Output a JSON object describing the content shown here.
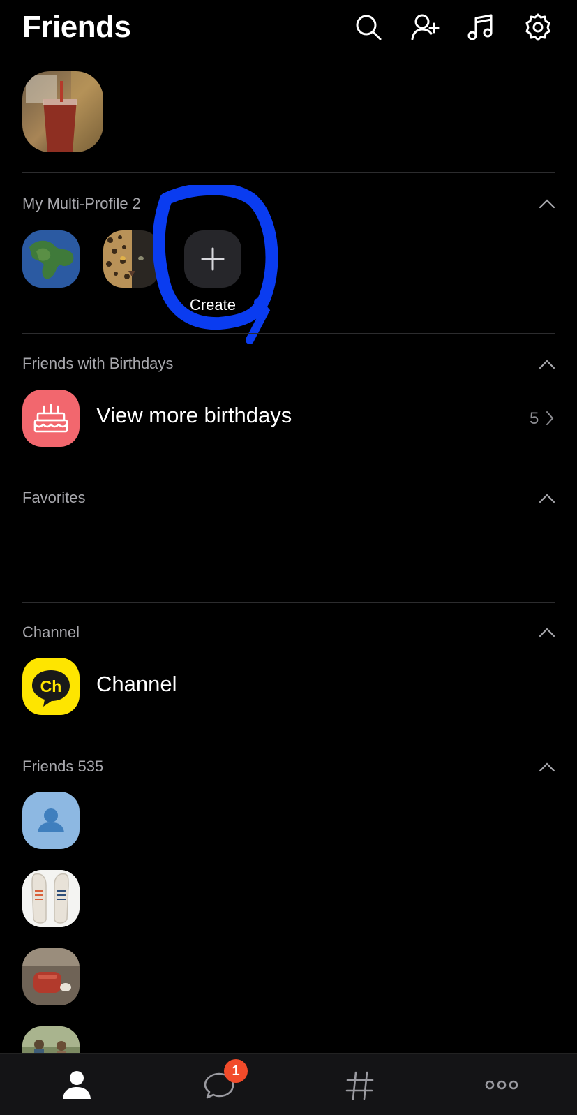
{
  "header": {
    "title": "Friends",
    "icons": [
      "search-icon",
      "add-friend-icon",
      "music-icon",
      "settings-icon"
    ]
  },
  "multi_profile": {
    "label": "My Multi-Profile 2",
    "create_label": "Create"
  },
  "birthdays": {
    "label": "Friends with Birthdays",
    "row_title": "View more birthdays",
    "count": "5"
  },
  "favorites": {
    "label": "Favorites"
  },
  "channel": {
    "label": "Channel",
    "row_title": "Channel",
    "logo_text": "Ch"
  },
  "friends": {
    "label": "Friends 535"
  },
  "tabbar": {
    "tabs": [
      "friends-tab",
      "chats-tab",
      "openchat-tab",
      "more-tab"
    ],
    "chat_badge": "1"
  },
  "colors": {
    "background": "#000000",
    "birthday_accent": "#f2676e",
    "channel_yellow": "#fee500",
    "badge": "#f24b2a",
    "annotation_blue": "#0a3cf0"
  }
}
